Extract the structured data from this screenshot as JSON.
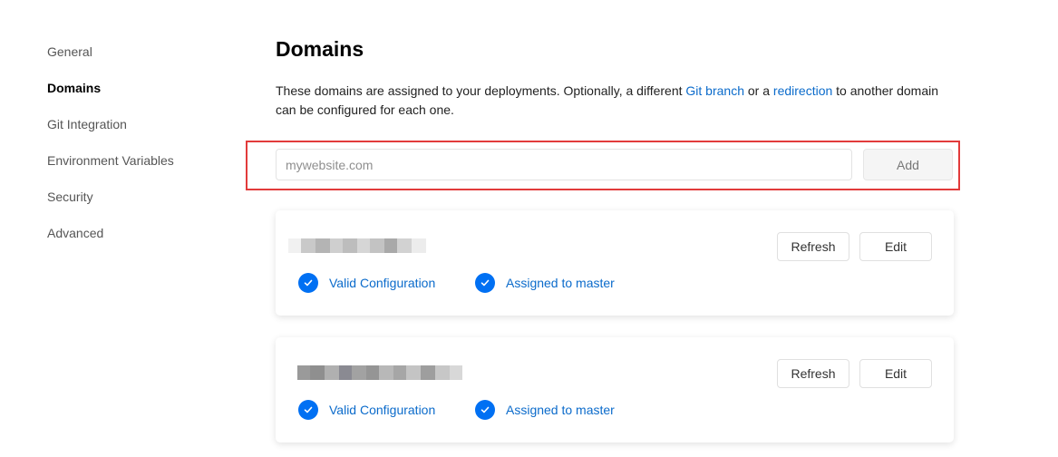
{
  "sidebar": {
    "items": [
      {
        "label": "General"
      },
      {
        "label": "Domains",
        "active": true
      },
      {
        "label": "Git Integration"
      },
      {
        "label": "Environment Variables"
      },
      {
        "label": "Security"
      },
      {
        "label": "Advanced"
      }
    ]
  },
  "main": {
    "title": "Domains",
    "description": {
      "part1": "These domains are assigned to your deployments. Optionally, a different ",
      "link1": "Git branch",
      "part2": " or a ",
      "link2": "redirection",
      "part3": " to another domain can be configured for each one."
    },
    "input": {
      "placeholder": "mywebsite.com",
      "value": ""
    },
    "add_label": "Add"
  },
  "domains": [
    {
      "refresh_label": "Refresh",
      "edit_label": "Edit",
      "status_valid": "Valid Configuration",
      "status_assigned": "Assigned to master"
    },
    {
      "refresh_label": "Refresh",
      "edit_label": "Edit",
      "status_valid": "Valid Configuration",
      "status_assigned": "Assigned to master"
    }
  ],
  "colors": {
    "accent": "#0070f3",
    "link": "#0b6bcb",
    "highlight": "#e23b3b"
  },
  "icons": {
    "status": "check-circle-icon"
  }
}
